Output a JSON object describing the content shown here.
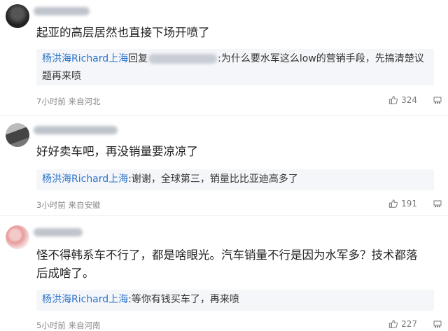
{
  "comments": [
    {
      "text": "起亚的高层居然也直接下场开喷了",
      "reply": {
        "author": "杨洪海Richard上海",
        "verb": "回复",
        "after_mention": ":为什么要水军这么low的营销手段，先搞清楚议题再来喷"
      },
      "meta": "7小时前 来自河北",
      "likes": "324"
    },
    {
      "text": "好好卖车吧，再没销量要凉凉了",
      "reply": {
        "author": "杨洪海Richard上海",
        "body": ":谢谢，全球第三，销量比比亚迪高多了"
      },
      "meta": "3小时前 来自安徽",
      "likes": "191"
    },
    {
      "text": "怪不得韩系车不行了，都是啥眼光。汽车销量不行是因为水军多？技术都落后成啥了。",
      "reply": {
        "author": "杨洪海Richard上海",
        "body": ":等你有钱买车了，再来喷"
      },
      "meta": "5小时前 来自河南",
      "likes": "227"
    }
  ],
  "colors": {
    "link_blue": "#2a73c9",
    "reply_bg": "#f4f6f9",
    "meta_gray": "#888888"
  }
}
